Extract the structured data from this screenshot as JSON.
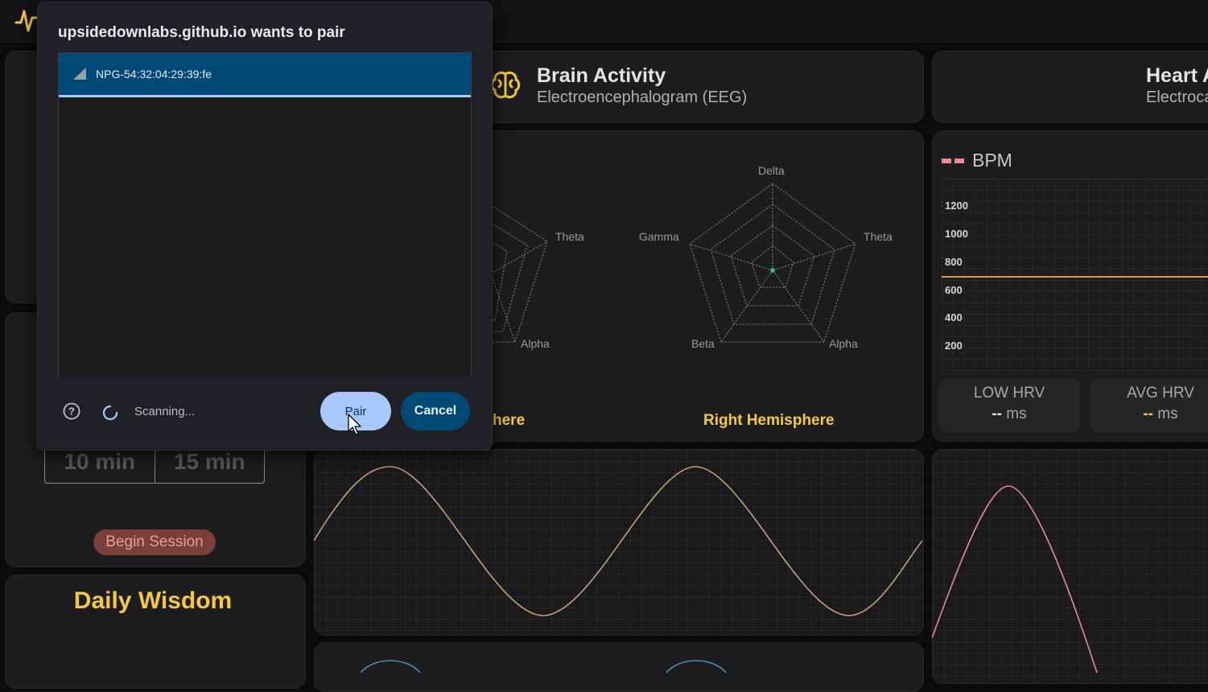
{
  "dialog": {
    "title": "upsidedownlabs.github.io wants to pair",
    "device_name": "NPG-54:32:04:29:39:fe",
    "status": "Scanning...",
    "pair_label": "Pair",
    "cancel_label": "Cancel"
  },
  "session": {
    "durations": [
      "10 min",
      "15 min"
    ],
    "begin_label": "Begin Session"
  },
  "wisdom": {
    "title": "Daily Wisdom"
  },
  "brain": {
    "title": "Brain Activity",
    "subtitle": "Electroencephalogram (EEG)",
    "left_hemisphere_partial": "here",
    "right_hemisphere": "Right Hemisphere",
    "radar_axes_right": [
      "Delta",
      "Theta",
      "Alpha",
      "Beta",
      "Gamma"
    ],
    "radar_axes_left_visible": [
      "Theta",
      "Alpha"
    ]
  },
  "heart": {
    "title_partial": "Heart A",
    "subtitle_partial": "Electroca",
    "bpm_legend": "BPM",
    "y_ticks": [
      "1200",
      "1000",
      "800",
      "600",
      "400",
      "200"
    ],
    "bpm_level": 700,
    "low_hrv_label": "LOW HRV",
    "low_hrv_value": "--",
    "avg_hrv_label": "AVG HRV",
    "avg_hrv_value": "--",
    "unit": "ms"
  },
  "colors": {
    "accent_yellow": "#f4c93a",
    "dialog_blue": "#004a77",
    "pair_blue": "#a8c7fa",
    "wave_tan": "#c8a070",
    "wave_pink": "#e8899a"
  },
  "icons": [
    "pulse-logo-icon",
    "brain-icon",
    "signal-icon",
    "help-icon",
    "spinner-icon",
    "cursor-icon"
  ]
}
